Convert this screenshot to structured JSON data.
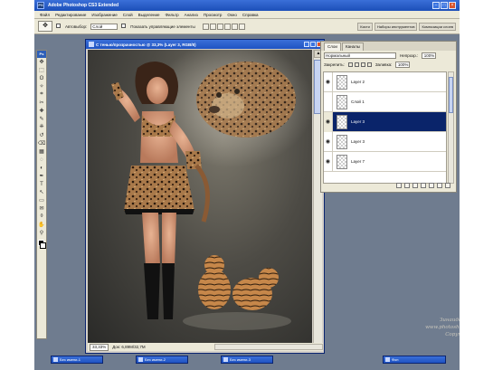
{
  "app": {
    "title": "Adobe Photoshop CS3 Extended",
    "logo": "PS"
  },
  "menu": [
    "Файл",
    "Редактирование",
    "Изображение",
    "Слой",
    "Выделение",
    "Фильтр",
    "Анализ",
    "Просмотр",
    "Окно",
    "Справка"
  ],
  "options": {
    "autoselect_label": "Автовыбор:",
    "autoselect_value": "Слой",
    "show_controls_label": "Показать управляющие элементы",
    "dock_tabs": [
      "Кисти",
      "Наборы инструментов",
      "Композиции слоев"
    ]
  },
  "toolbox": {
    "badge": "Ps",
    "tools": [
      "move-tool-icon",
      "marquee-tool-icon",
      "lasso-tool-icon",
      "magic-wand-icon",
      "crop-tool-icon",
      "slice-tool-icon",
      "healing-brush-icon",
      "brush-tool-icon",
      "stamp-tool-icon",
      "history-brush-icon",
      "eraser-tool-icon",
      "gradient-tool-icon",
      "blur-tool-icon",
      "dodge-tool-icon",
      "pen-tool-icon",
      "type-tool-icon",
      "path-select-icon",
      "shape-tool-icon",
      "notes-tool-icon",
      "eyedropper-icon",
      "hand-tool-icon",
      "zoom-tool-icon"
    ],
    "tool_glyphs": [
      "✥",
      "⬚",
      "ʘ",
      "✧",
      "⌗",
      "✂",
      "✚",
      "✎",
      "⎈",
      "↺",
      "⌫",
      "▦",
      "◌",
      "◐",
      "✒",
      "T",
      "↖",
      "▭",
      "✉",
      "⌽",
      "✋",
      "⚲"
    ]
  },
  "document": {
    "title": "С тенью/прозрачностью @ 33,3% (Layer 3, RGB/8)",
    "zoom": "33,33%",
    "info": "Док: 6,89M/32,7M"
  },
  "layers_panel": {
    "tabs": [
      "Слои",
      "Каналы"
    ],
    "blend_mode": "Нормальный",
    "opacity_label": "Непрозр.:",
    "opacity_value": "100%",
    "lock_label": "Закрепить:",
    "fill_label": "Заливка:",
    "fill_value": "100%",
    "layers": [
      {
        "name": "Layer 2",
        "visible": true,
        "selected": false
      },
      {
        "name": "Слой 1",
        "visible": false,
        "selected": false
      },
      {
        "name": "Layer 3",
        "visible": true,
        "selected": true
      },
      {
        "name": "Layer 3",
        "visible": true,
        "selected": false
      },
      {
        "name": "Layer 7",
        "visible": true,
        "selected": false
      }
    ]
  },
  "minimized_docs": [
    "Без имени-1",
    "Без имени-2",
    "Без имени-3",
    "Фон"
  ],
  "watermark": {
    "line1": "Зинаида Лукьянова",
    "line2": "www.photoshop-master.ru",
    "line3": "Copyright © 2008"
  }
}
